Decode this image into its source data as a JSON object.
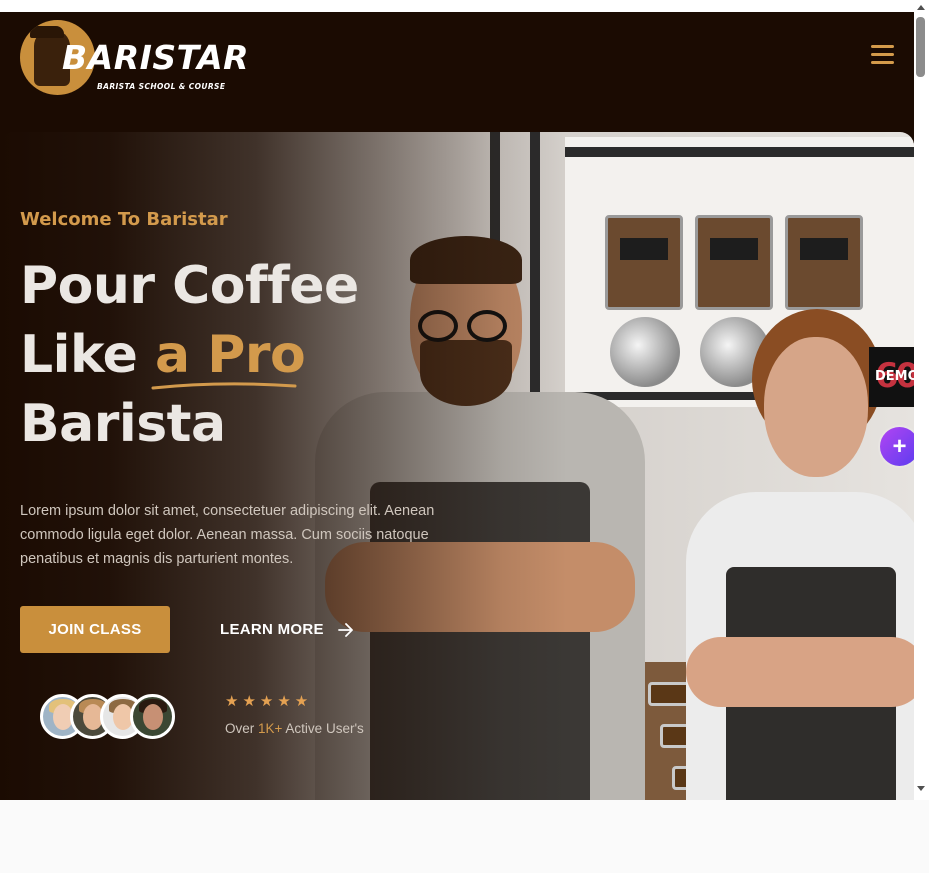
{
  "brand": {
    "name": "BARISTAR",
    "tagline": "BARISTA SCHOOL & COURSE"
  },
  "header": {
    "menu_icon": "hamburger-menu-icon"
  },
  "hero": {
    "welcome": "Welcome To Baristar",
    "title_line1": "Pour Coffee",
    "title_line2_prefix": "Like ",
    "title_line2_accent": "a Pro",
    "title_line3": "Barista",
    "description": "Lorem ipsum dolor sit amet, consectetuer adipiscing elit. Aenean commodo ligula eget dolor. Aenean massa. Cum sociis natoque penatibus et magnis dis parturient montes.",
    "join_button": "JOIN CLASS",
    "learn_button": "LEARN MORE",
    "learn_icon": "arrow-right-icon",
    "rating": "★★★★★",
    "users_prefix": "Over ",
    "users_highlight": "1K+",
    "users_suffix": " Active User's"
  },
  "side_tools": {
    "demos_glyph": "60",
    "demos_label": "DEMOS",
    "plus_label": "+"
  },
  "colors": {
    "accent": "#c98f3c",
    "background": "#1b0b02",
    "text_light": "#ebe7e3",
    "star": "#e4a152",
    "plus_gradient_start": "#b245f2",
    "plus_gradient_end": "#5b3cf0"
  }
}
